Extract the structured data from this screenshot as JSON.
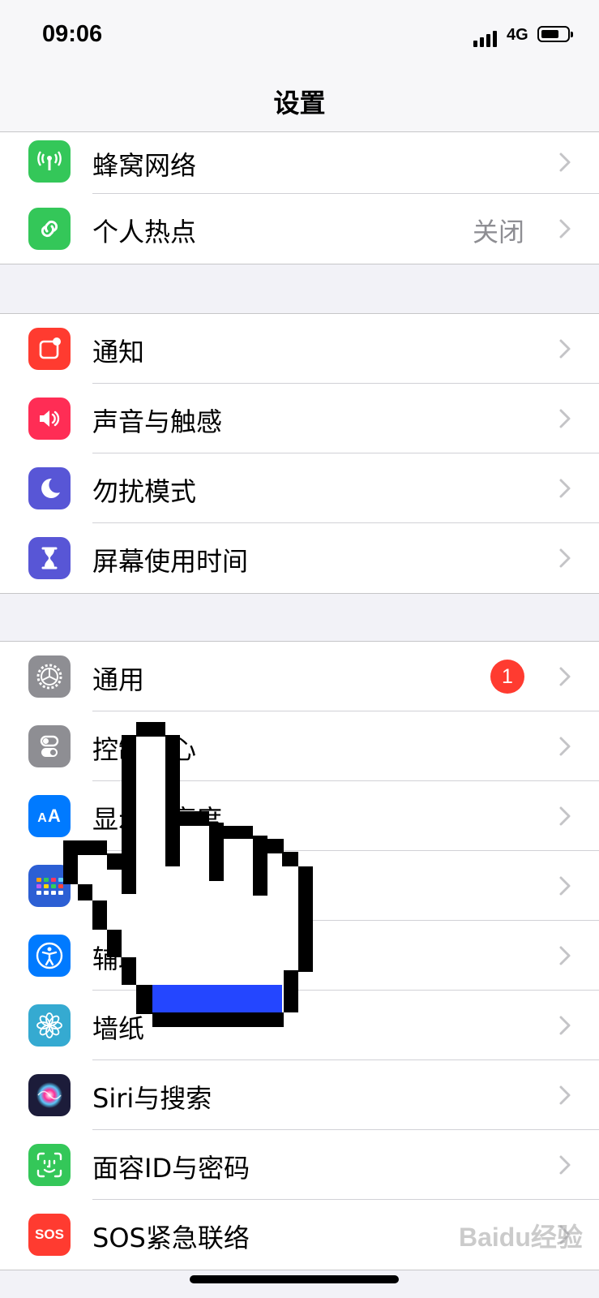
{
  "status_bar": {
    "time": "09:06",
    "network": "4G",
    "battery_level": 0.65
  },
  "nav": {
    "title": "设置"
  },
  "groups": [
    {
      "rows": [
        {
          "label": "蜂窝网络",
          "value": "",
          "icon": "antenna-icon",
          "color": "#34c759"
        },
        {
          "label": "个人热点",
          "value": "关闭",
          "icon": "hotspot-icon",
          "color": "#34c759"
        }
      ]
    },
    {
      "rows": [
        {
          "label": "通知",
          "value": "",
          "icon": "notifications-icon",
          "color": "#ff3b30"
        },
        {
          "label": "声音与触感",
          "value": "",
          "icon": "speaker-icon",
          "color": "#ff2d55"
        },
        {
          "label": "勿扰模式",
          "value": "",
          "icon": "moon-icon",
          "color": "#5856d6"
        },
        {
          "label": "屏幕使用时间",
          "value": "",
          "icon": "hourglass-icon",
          "color": "#5856d6"
        }
      ]
    },
    {
      "rows": [
        {
          "label": "通用",
          "badge": "1",
          "icon": "gear-icon",
          "color": "#8e8e93"
        },
        {
          "label": "控制中心",
          "value": "",
          "icon": "toggles-icon",
          "color": "#8e8e93"
        },
        {
          "label": "显示与亮度",
          "value": "",
          "icon": "text-size-icon",
          "color": "#007aff"
        },
        {
          "label": "主屏幕",
          "value": "",
          "icon": "home-screen-icon",
          "color": "#2c5fd4"
        },
        {
          "label": "辅助功能",
          "value": "",
          "icon": "accessibility-icon",
          "color": "#007aff"
        },
        {
          "label": "墙纸",
          "value": "",
          "icon": "flower-icon",
          "color": "#35aad1"
        },
        {
          "label": "Siri与搜索",
          "value": "",
          "icon": "siri-icon",
          "color": "#1c1c3a"
        },
        {
          "label": "面容ID与密码",
          "value": "",
          "icon": "face-id-icon",
          "color": "#34c759"
        },
        {
          "label": "SOS紧急联络",
          "value": "",
          "icon": "sos-icon",
          "color": "#ff3b30",
          "icon_text": "SOS"
        }
      ]
    }
  ],
  "watermark": "Baidu经验",
  "colors": {
    "accent_blue": "#2446ff",
    "separator": "#c6c6c8",
    "background": "#f2f2f7"
  }
}
